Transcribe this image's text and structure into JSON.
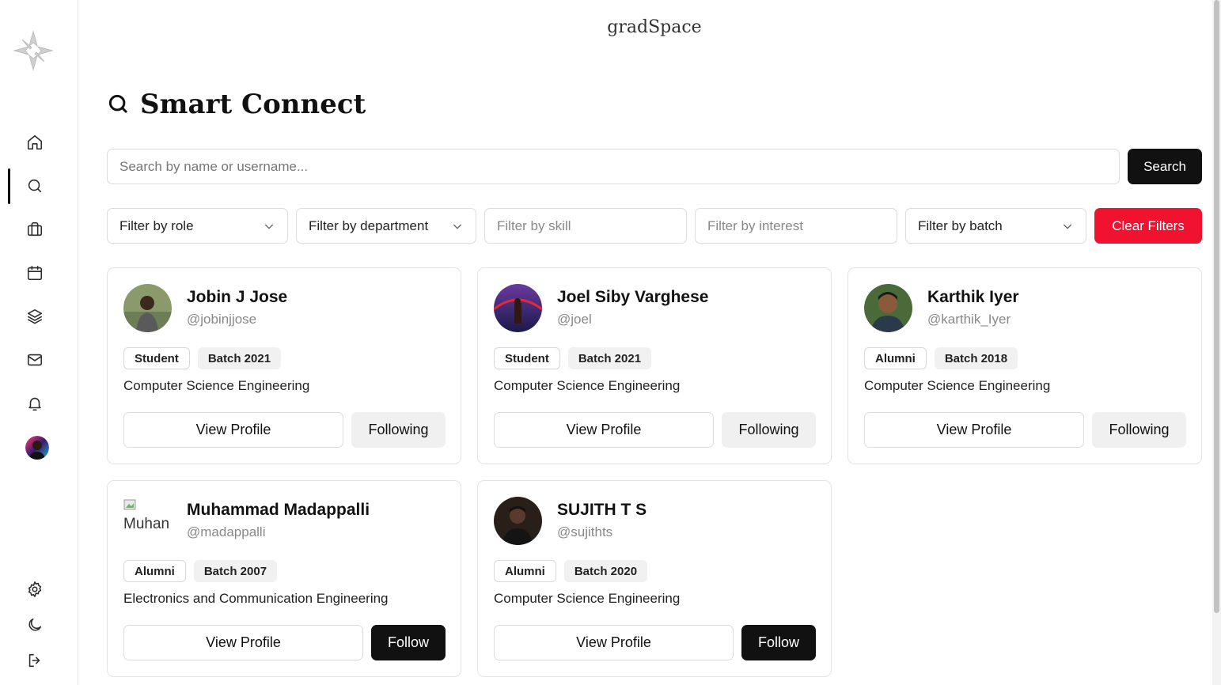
{
  "app": {
    "brand": "gradSpace"
  },
  "page": {
    "title": "Smart Connect"
  },
  "sidebar": {
    "icons": [
      "logo-icon",
      "home-icon",
      "search-icon",
      "briefcase-icon",
      "calendar-icon",
      "layers-icon",
      "mail-icon",
      "bell-icon",
      "avatar",
      "settings-icon",
      "moon-icon",
      "logout-icon"
    ],
    "active": "search"
  },
  "search": {
    "placeholder": "Search by name or username...",
    "button": "Search"
  },
  "filters": {
    "role": "Filter by role",
    "department": "Filter by department",
    "skill_placeholder": "Filter by skill",
    "interest_placeholder": "Filter by interest",
    "batch": "Filter by batch",
    "clear": "Clear Filters"
  },
  "users": [
    {
      "name": "Jobin J Jose",
      "handle": "@jobinjjose",
      "role": "Student",
      "batch": "Batch 2021",
      "department": "Computer Science Engineering",
      "view": "View Profile",
      "action": "Following"
    },
    {
      "name": "Joel Siby Varghese",
      "handle": "@joel",
      "role": "Student",
      "batch": "Batch 2021",
      "department": "Computer Science Engineering",
      "view": "View Profile",
      "action": "Following"
    },
    {
      "name": "Karthik Iyer",
      "handle": "@karthik_Iyer",
      "role": "Alumni",
      "batch": "Batch 2018",
      "department": "Computer Science Engineering",
      "view": "View Profile",
      "action": "Following"
    },
    {
      "name": "Muhammad Madappalli",
      "handle": "@madappalli",
      "role": "Alumni",
      "batch": "Batch 2007",
      "department": "Electronics and Communication Engineering",
      "view": "View Profile",
      "action": "Follow",
      "broken_image_alt": "Muhan"
    },
    {
      "name": "SUJITH T S",
      "handle": "@sujithts",
      "role": "Alumni",
      "batch": "Batch 2020",
      "department": "Computer Science Engineering",
      "view": "View Profile",
      "action": "Follow"
    }
  ],
  "colors": {
    "primary": "#111111",
    "danger": "#f0122f",
    "muted": "#888888",
    "border": "#dcdcdc"
  }
}
